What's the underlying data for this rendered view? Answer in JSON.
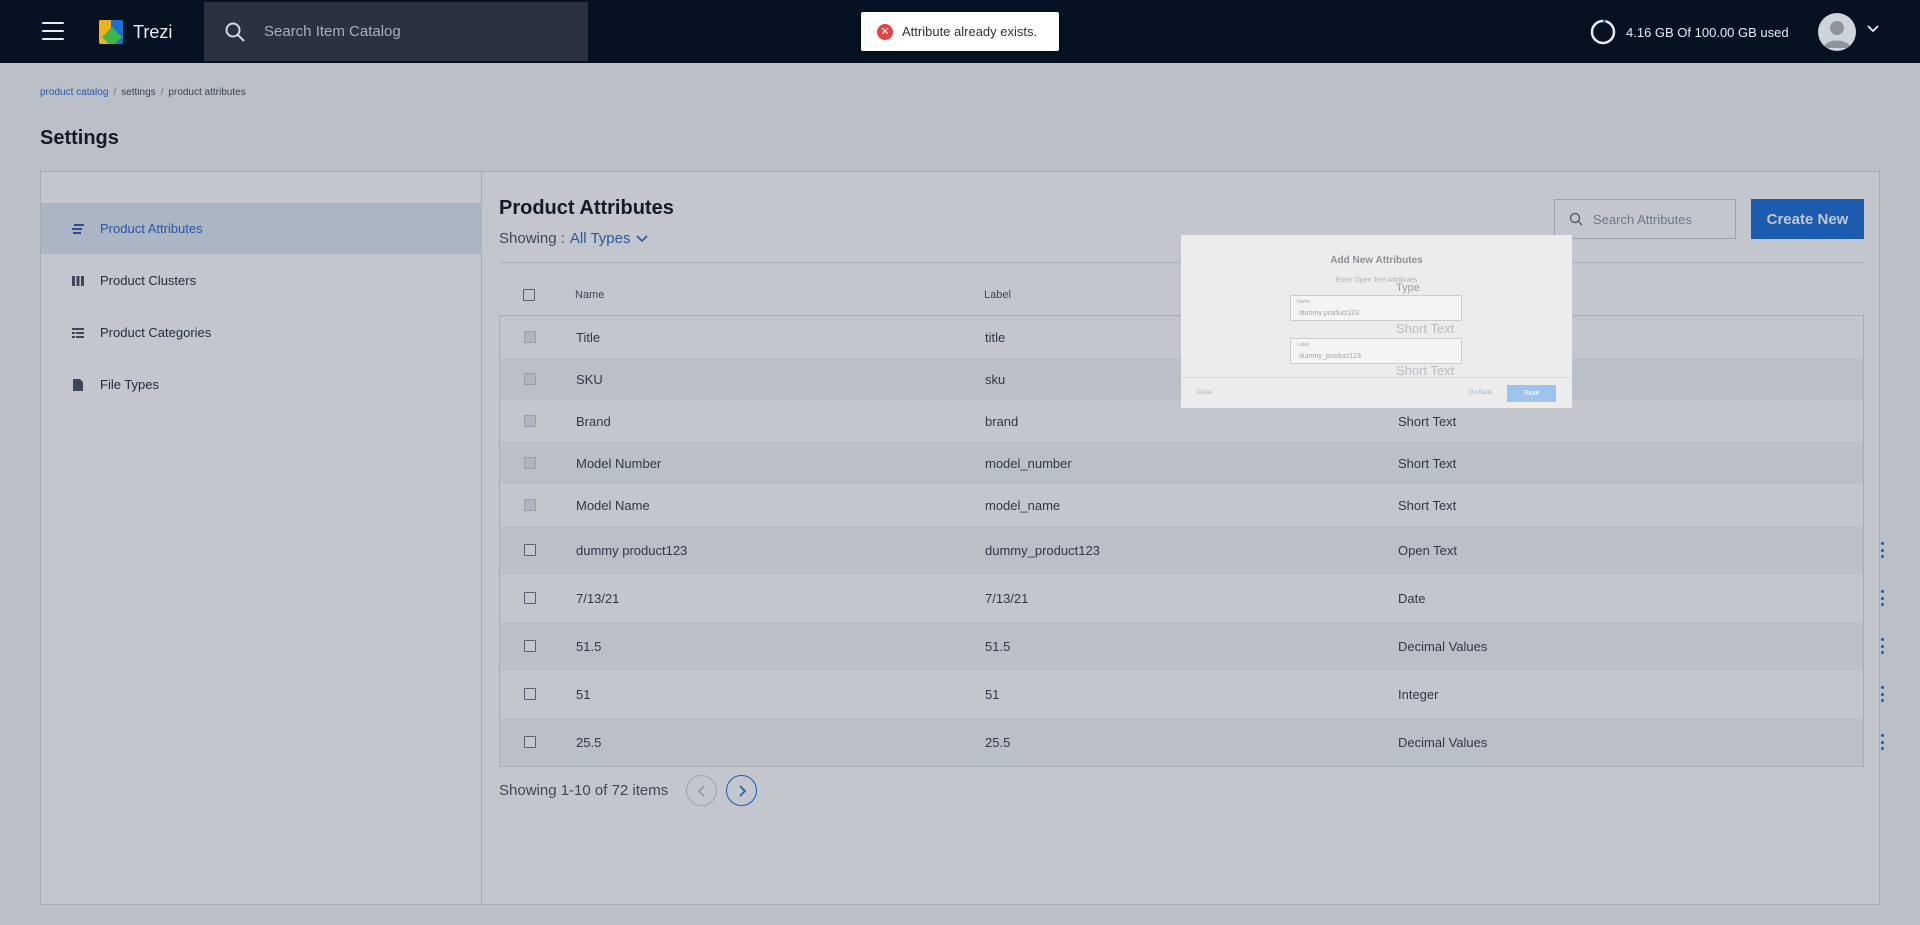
{
  "app": {
    "name": "Trezi"
  },
  "header": {
    "search_placeholder": "Search Item Catalog",
    "storage_text": "4.16 GB Of 100.00 GB used",
    "storage_used_fraction": 0.0416
  },
  "toast": {
    "message": "Attribute already exists.",
    "icon": "error-icon",
    "color": "#e54343"
  },
  "breadcrumb": {
    "items": [
      "product catalog",
      "settings",
      "product attributes"
    ]
  },
  "page": {
    "title": "Settings"
  },
  "sidebar": {
    "items": [
      {
        "label": "Product Attributes",
        "icon": "attributes-icon",
        "active": true
      },
      {
        "label": "Product Clusters",
        "icon": "clusters-icon",
        "active": false
      },
      {
        "label": "Product Categories",
        "icon": "categories-icon",
        "active": false
      },
      {
        "label": "File Types",
        "icon": "file-icon",
        "active": false
      }
    ]
  },
  "content": {
    "title": "Product Attributes",
    "showing_label": "Showing :",
    "showing_value": "All Types",
    "search_placeholder": "Search Attributes",
    "create_label": "Create New",
    "accent_color": "#1f6fd9"
  },
  "table": {
    "columns": [
      "Name",
      "Label",
      "Type"
    ],
    "rows": [
      {
        "name": "Title",
        "label": "title",
        "type": "Short Text"
      },
      {
        "name": "SKU",
        "label": "sku",
        "type": "Short Text"
      },
      {
        "name": "Brand",
        "label": "brand",
        "type": "Short Text"
      },
      {
        "name": "Model Number",
        "label": "model_number",
        "type": "Short Text"
      },
      {
        "name": "Model Name",
        "label": "model_name",
        "type": "Short Text"
      },
      {
        "name": "dummy product123",
        "label": "dummy_product123",
        "type": "Open Text"
      },
      {
        "name": "7/13/21",
        "label": "7/13/21",
        "type": "Date"
      },
      {
        "name": "51.5",
        "label": "51.5",
        "type": "Decimal Values"
      },
      {
        "name": "51",
        "label": "51",
        "type": "Integer"
      },
      {
        "name": "25.5",
        "label": "25.5",
        "type": "Decimal Values"
      }
    ]
  },
  "pagination": {
    "text": "Showing 1-10 of 72 items"
  },
  "modal": {
    "title": "Add New Attributes",
    "subtitle": "Enter Open Text Attributes",
    "name_label": "Name",
    "name_value": "dummy product123",
    "label_label": "Label",
    "label_value": "dummy_product123",
    "close_label": "Close",
    "goback_label": "Go Back",
    "save_label": "Save"
  }
}
